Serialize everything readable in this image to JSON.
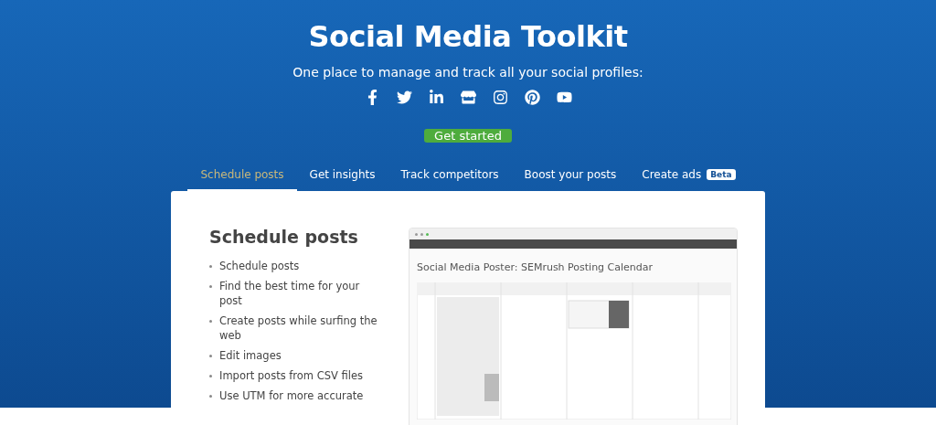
{
  "hero": {
    "title": "Social Media Toolkit",
    "subtitle": "One place to manage and track all your social profiles:",
    "cta": "Get started"
  },
  "tabs": [
    {
      "label": "Schedule posts",
      "selected": true
    },
    {
      "label": "Get insights",
      "selected": false
    },
    {
      "label": "Track competitors",
      "selected": false
    },
    {
      "label": "Boost your posts",
      "selected": false
    },
    {
      "label": "Create ads",
      "selected": false,
      "badge": "Beta"
    }
  ],
  "panel": {
    "heading": "Schedule posts",
    "features": [
      "Schedule posts",
      "Find the best time for your post",
      "Create posts while surfing the web",
      "Edit images",
      "Import posts from CSV files",
      "Use UTM for more accurate"
    ],
    "preview": {
      "title": "Social Media Poster: SEMrush Posting Calendar"
    }
  }
}
